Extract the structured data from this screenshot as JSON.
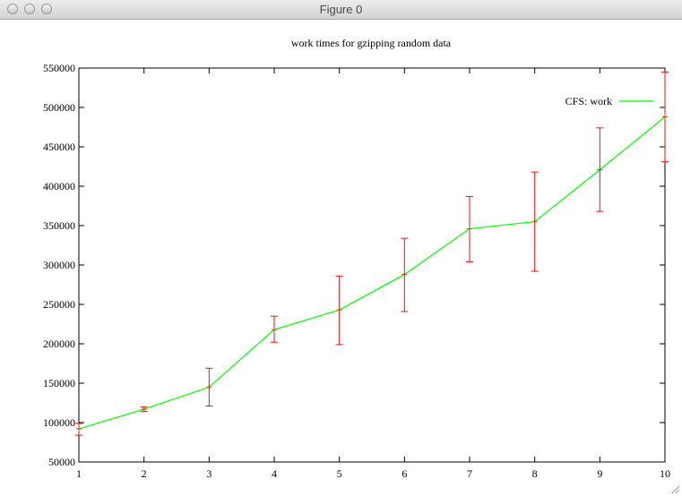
{
  "window": {
    "title": "Figure 0"
  },
  "chart_data": {
    "type": "line",
    "title": "work times for gzipping random data",
    "xlabel": "",
    "ylabel": "",
    "xlim": [
      1,
      10
    ],
    "ylim": [
      50000,
      550000
    ],
    "x_ticks": [
      1,
      2,
      3,
      4,
      5,
      6,
      7,
      8,
      9,
      10
    ],
    "y_ticks": [
      50000,
      100000,
      150000,
      200000,
      250000,
      300000,
      350000,
      400000,
      450000,
      500000,
      550000
    ],
    "grid": false,
    "legend_position": "top-right",
    "series": [
      {
        "name": "CFS: work",
        "color": "#00ff00",
        "error_color": "#ee1111",
        "x": [
          1,
          2,
          3,
          4,
          5,
          6,
          7,
          8,
          9,
          10
        ],
        "y": [
          92000,
          117000,
          145000,
          218000,
          243000,
          288000,
          346000,
          355000,
          421000,
          488000
        ],
        "yerr_low": [
          84000,
          114000,
          121000,
          202000,
          199000,
          241000,
          304000,
          292000,
          368000,
          431000
        ],
        "yerr_high": [
          99000,
          120000,
          169000,
          235000,
          286000,
          334000,
          387000,
          418000,
          474000,
          545000
        ]
      }
    ]
  }
}
